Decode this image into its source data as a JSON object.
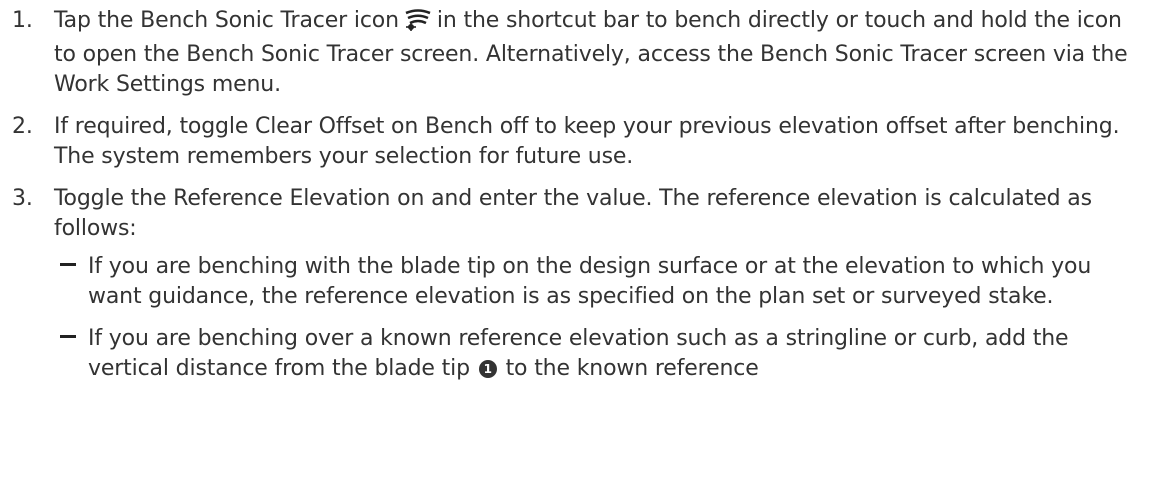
{
  "steps": [
    {
      "num": "1.",
      "text_before_icon": "Tap the Bench Sonic Tracer icon",
      "icon": "sonic-tracer-icon",
      "text_after_icon": "in the shortcut bar to bench directly or touch and hold the icon to open the Bench Sonic Tracer screen. Alternatively, access the Bench Sonic Tracer screen via the Work Settings menu."
    },
    {
      "num": "2.",
      "text": "If required, toggle Clear Offset on Bench off to keep your previous elevation offset after benching. The system remembers your selection for future use."
    },
    {
      "num": "3.",
      "text": "Toggle the Reference Elevation on and enter the value. The reference elevation is calculated as follows:",
      "sub_items": [
        {
          "text": "If you are benching with the blade tip on the design surface or at the elevation to which you want guidance, the reference elevation is as specified on the plan set or surveyed stake."
        },
        {
          "text_before_callout": "If you are benching over a known reference elevation such as a stringline or curb, add the vertical distance from the blade tip",
          "callout": "1",
          "text_after_callout": "to the known reference"
        }
      ]
    }
  ]
}
